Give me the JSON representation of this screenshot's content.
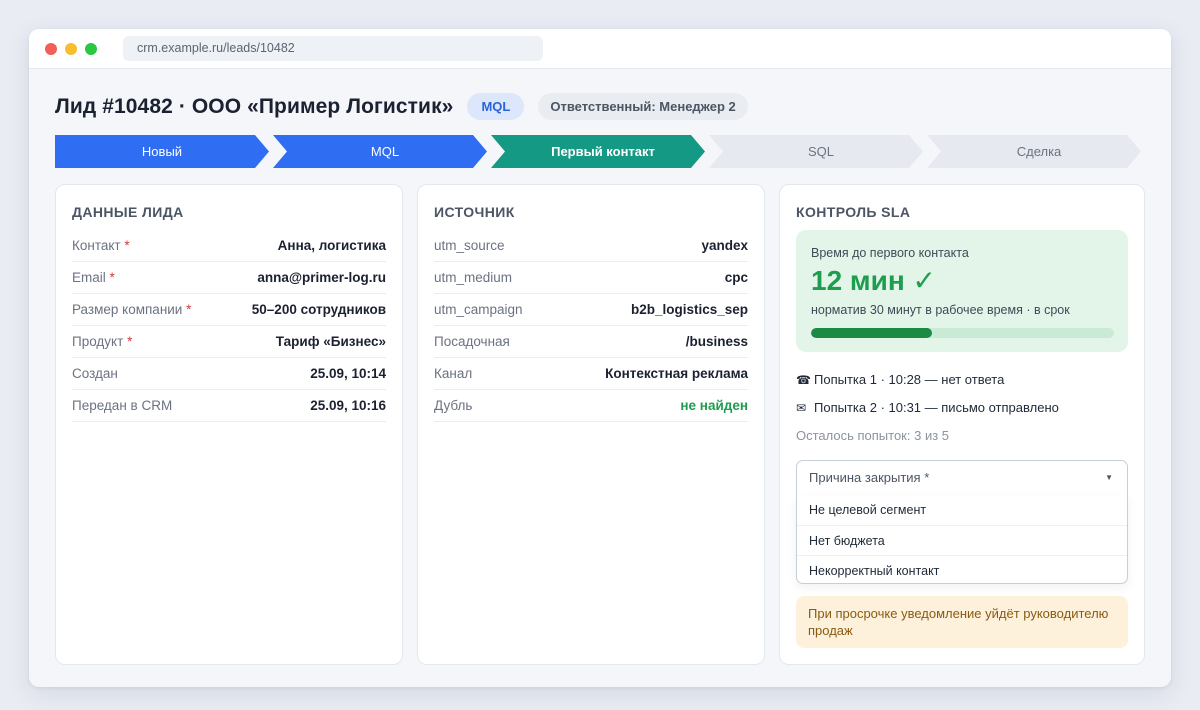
{
  "browser": {
    "url": "crm.example.ru/leads/10482"
  },
  "header": {
    "title": "Лид #10482 · ООО «Пример Логистик»",
    "status_badge": "MQL",
    "owner_badge": "Ответственный: Менеджер 2"
  },
  "pipeline": {
    "stages": [
      {
        "label": "Новый",
        "state": "done"
      },
      {
        "label": "MQL",
        "state": "done"
      },
      {
        "label": "Первый контакт",
        "state": "active"
      },
      {
        "label": "SQL",
        "state": "todo"
      },
      {
        "label": "Сделка",
        "state": "todo"
      }
    ]
  },
  "lead_card": {
    "title": "ДАННЫЕ ЛИДА",
    "required_mark": "*",
    "rows": [
      {
        "label": "Контакт",
        "value": "Анна, логистика"
      },
      {
        "label": "Email",
        "value": "anna@primer-log.ru"
      },
      {
        "label": "Размер компании",
        "value": "50–200 сотрудников"
      },
      {
        "label": "Продукт",
        "value": "Тариф «Бизнес»"
      },
      {
        "label": "Создан",
        "value": "25.09, 10:14"
      },
      {
        "label": "Передан в CRM",
        "value": "25.09, 10:16"
      }
    ]
  },
  "source_card": {
    "title": "ИСТОЧНИК",
    "rows": [
      {
        "label": "utm_source",
        "value": "yandex"
      },
      {
        "label": "utm_medium",
        "value": "cpc"
      },
      {
        "label": "utm_campaign",
        "value": "b2b_logistics_sep"
      },
      {
        "label": "Посадочная",
        "value": "/business"
      },
      {
        "label": "Канал",
        "value": "Контекстная реклама"
      },
      {
        "label": "Дубль",
        "value": "не найден"
      }
    ]
  },
  "sla_card": {
    "title": "КОНТРОЛЬ SLA",
    "caption": "Время до первого контакта",
    "big_value": "12 мин ✓",
    "note": "норматив 30 минут в рабочее время · в срок",
    "progress_fraction": 0.4,
    "attempts": [
      {
        "icon": "phone-icon",
        "text": "Попытка 1 · 10:28 — нет ответа"
      },
      {
        "icon": "envelope-icon",
        "text": "Попытка 2 · 10:31 — письмо отправлено"
      }
    ],
    "remaining": "Осталось попыток: 3 из 5",
    "close_reason": {
      "placeholder": "Причина закрытия *",
      "options": [
        "Не целевой сегмент",
        "Нет бюджета",
        "Некорректный контакт"
      ]
    },
    "warning": "При просрочке уведомление уйдёт руководителю продаж"
  },
  "colors": {
    "stage_done": "#2f6df2",
    "stage_active": "#149a84",
    "stage_todo": "#e6e9f0",
    "sla_green": "#1f9d4e",
    "required_red": "#d23b3b"
  }
}
